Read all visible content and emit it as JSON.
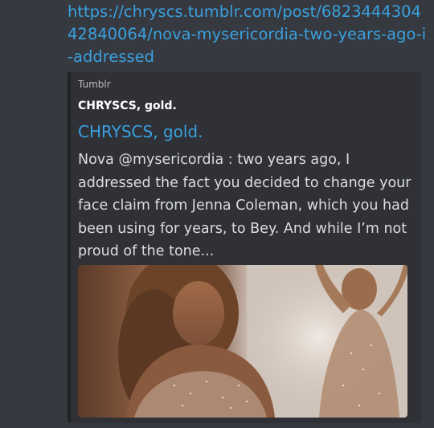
{
  "message": {
    "link_text": "https://chryscs.tumblr.com/post/682344430442840064/nova-mysericordia-two-years-ago-i-addressed"
  },
  "embed": {
    "provider": "Tumblr",
    "author": "CHRYSCS, gold.",
    "title": "CHRYSCS, gold.",
    "description": "Nova @mysericordia : two years ago, I addressed the fact you decided to change your face claim from Jenna Coleman, which you had been using for years, to Bey. And while I’m not proud of the tone...",
    "image_alt": "photo of a woman in a sparkling sheer gown, two poses"
  },
  "colors": {
    "background": "#36393f",
    "embed_background": "#2f3136",
    "embed_border": "#202225",
    "link": "#3aa0df",
    "text": "#dcddde",
    "muted": "#b9bbbe"
  }
}
